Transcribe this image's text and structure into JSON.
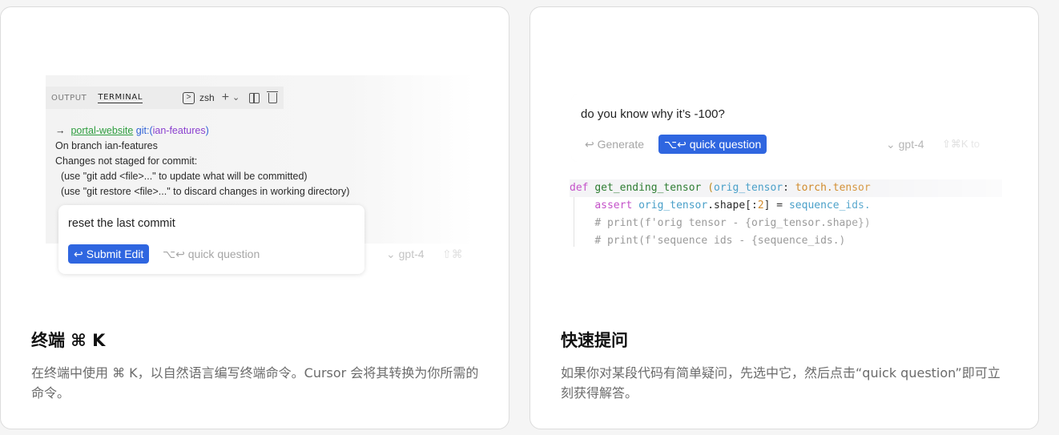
{
  "left_card": {
    "terminal": {
      "tabs": [
        "OUTPUT",
        "TERMINAL"
      ],
      "shell_label": "zsh",
      "lines": [
        {
          "arrow": "→",
          "repo": "portal-website",
          "git": "git:(",
          "branch": "ian-features",
          "close": ")"
        },
        "On branch ian-features",
        "Changes not staged for commit:",
        "  (use \"git add <file>...\" to update what will be committed)",
        "  (use \"git restore <file>...\" to discard changes in working directory)"
      ]
    },
    "cmdk": {
      "input_text": "reset the last commit",
      "submit_label": "Submit Edit",
      "submit_icon": "↩",
      "quick_label": "⌥↩ quick question",
      "model_label": "gpt-4",
      "shortcut_label": "⇧⌘"
    },
    "title": "终端 ⌘ K",
    "description": "在终端中使用 ⌘ K，以自然语言编写终端命令。Cursor 会将其转换为你所需的命令。"
  },
  "right_card": {
    "question_box": {
      "input_text": "do you know why it’s -100?",
      "generate_label": "↩ Generate",
      "quick_label": "⌥↩ quick question",
      "model_label": "gpt-4",
      "shortcut_label": "⇧⌘K to"
    },
    "code": {
      "line1": {
        "kw": "def",
        "fn": "get_ending_tensor",
        "paren": "(",
        "param": "orig_tensor",
        "colon": ":",
        "type1": "torch",
        "type2": ".tensor"
      },
      "line2": {
        "kw": "assert",
        "a": "orig_tensor",
        "b": ".shape",
        "c": "[:",
        "d": "2",
        "e": "] = ",
        "f": "sequence_ids."
      },
      "line3": "# print(f'orig tensor - {orig_tensor.shape})",
      "line4": "# print(f'sequence ids - {sequence_ids.)"
    },
    "title": "快速提问",
    "description": "如果你对某段代码有简单疑问，先选中它，然后点击“quick question”即可立刻获得解答。"
  },
  "colors": {
    "accent": "#2f66e0",
    "repo_green": "#2e9e3f",
    "git_blue": "#2f62d6",
    "branch_purple": "#8a3fcf"
  }
}
